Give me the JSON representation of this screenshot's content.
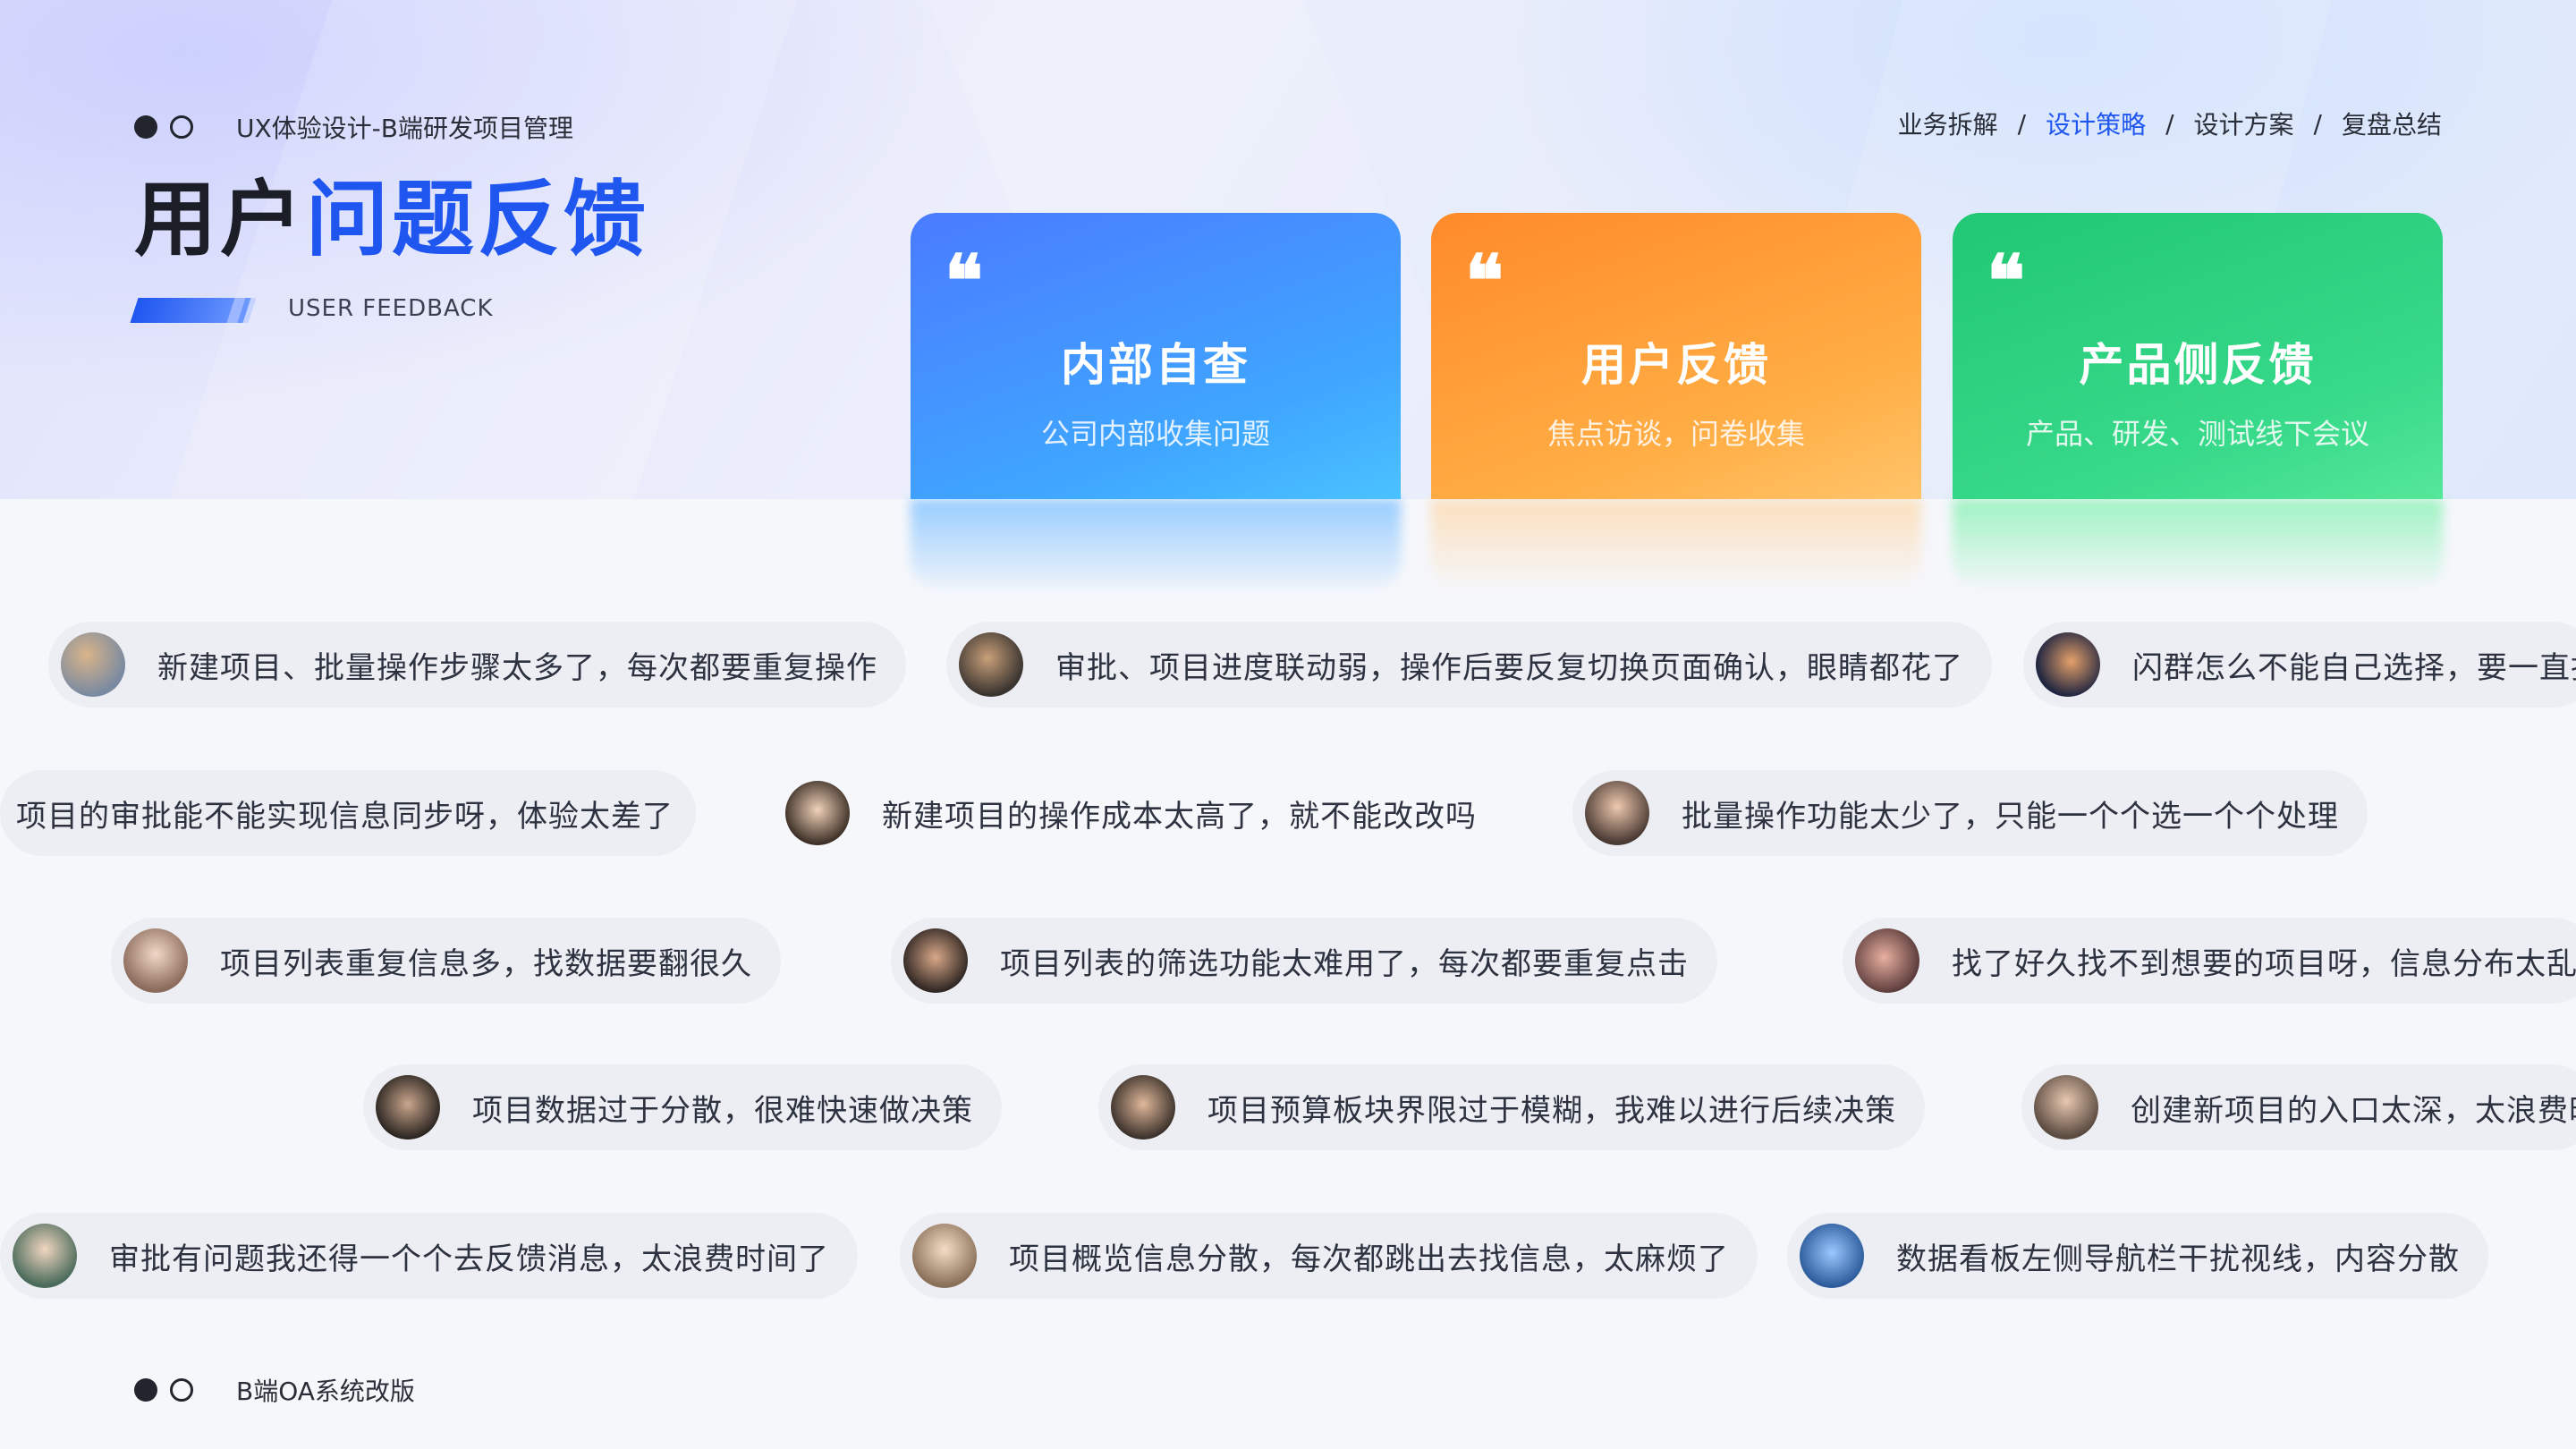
{
  "header": {
    "project_label": "UX体验设计-B端研发项目管理",
    "title_part1": "用户",
    "title_part2": "问题反馈",
    "subtitle": "USER FEEDBACK"
  },
  "nav": {
    "items": [
      "业务拆解",
      "设计策略",
      "设计方案",
      "复盘总结"
    ],
    "active_index": 1,
    "separator": "/"
  },
  "cards": [
    {
      "icon": "quote-icon",
      "quote": "❝",
      "title": "内部自查",
      "subtitle": "公司内部收集问题",
      "color": "#3f8bff"
    },
    {
      "icon": "quote-icon",
      "quote": "❝",
      "title": "用户反馈",
      "subtitle": "焦点访谈，问卷收集",
      "color": "#ff9a35"
    },
    {
      "icon": "quote-icon",
      "quote": "❝",
      "title": "产品侧反馈",
      "subtitle": "产品、研发、测试线下会议",
      "color": "#2bd27e"
    }
  ],
  "feedback_rows": [
    [
      "新建项目、批量操作步骤太多了，每次都要重复操作",
      "审批、项目进度联动弱，操作后要反复切换页面确认，眼睛都花了",
      "闪群怎么不能自己选择，要一直找"
    ],
    [
      "项目的审批能不能实现信息同步呀，体验太差了",
      "新建项目的操作成本太高了，就不能改改吗",
      "批量操作功能太少了，只能一个个选一个个处理"
    ],
    [
      "项目列表重复信息多，找数据要翻很久",
      "项目列表的筛选功能太难用了，每次都要重复点击",
      "找了好久找不到想要的项目呀，信息分布太乱了"
    ],
    [
      "项目数据过于分散，很难快速做决策",
      "项目预算板块界限过于模糊，我难以进行后续决策",
      "创建新项目的入口太深，太浪费时间了"
    ],
    [
      "审批有问题我还得一个个去反馈消息，太浪费时间了",
      "项目概览信息分散，每次都跳出去找信息，太麻烦了",
      "数据看板左侧导航栏干扰视线，内容分散"
    ]
  ],
  "footer": {
    "label": "B端OA系统改版"
  },
  "colors": {
    "accent": "#1f56f0",
    "dark": "#1b1e27"
  }
}
